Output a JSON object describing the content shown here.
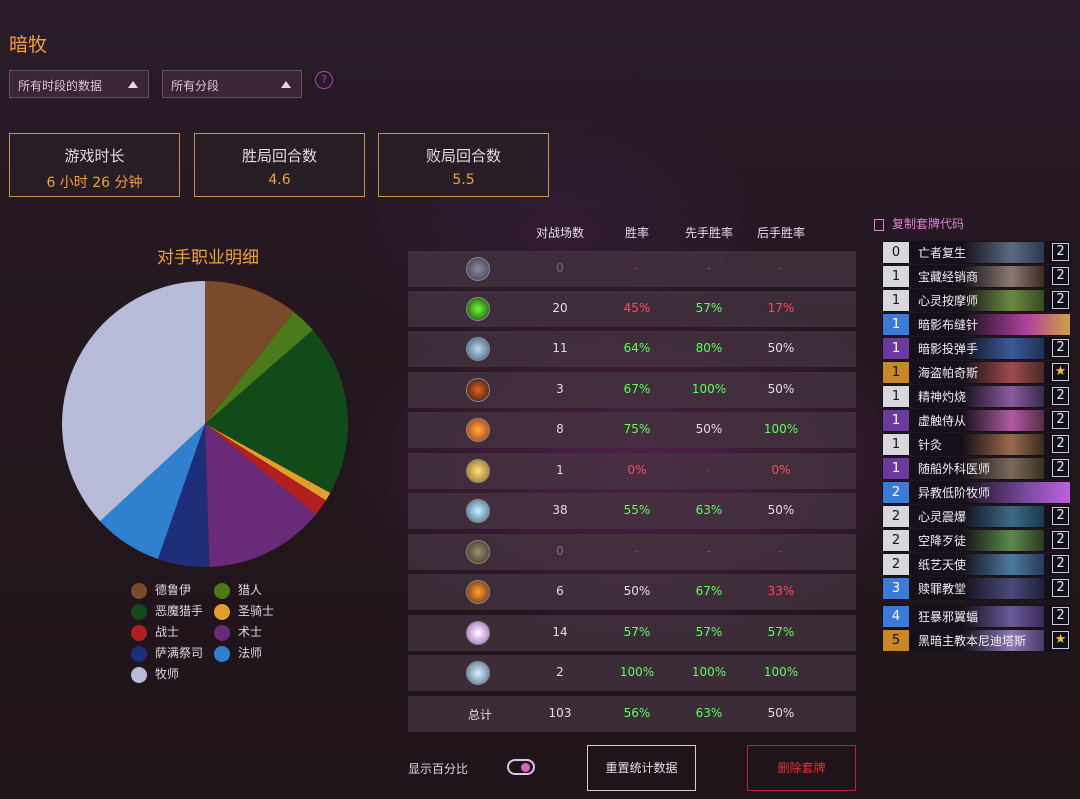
{
  "header": {
    "title": "暗牧"
  },
  "filters": {
    "time_range": "所有时段的数据",
    "rank_range": "所有分段",
    "help": "?"
  },
  "stats": [
    {
      "label": "游戏时长",
      "value": "6 小时 26 分钟"
    },
    {
      "label": "胜局回合数",
      "value": "4.6"
    },
    {
      "label": "败局回合数",
      "value": "5.5"
    }
  ],
  "chart_data": {
    "type": "pie",
    "title": "对手职业明细",
    "labels": [
      "德鲁伊",
      "猎人",
      "恶魔猎手",
      "圣骑士",
      "战士",
      "术士",
      "萨满祭司",
      "法师",
      "牧师"
    ],
    "values": [
      11,
      3,
      20,
      1,
      2,
      14,
      6,
      8,
      38
    ],
    "colors": [
      "#7a4a2a",
      "#4a7a1a",
      "#134a1a",
      "#e0a02a",
      "#b02020",
      "#6a2a7a",
      "#1e2e7a",
      "#3080d0",
      "#b8bcd8"
    ]
  },
  "legend": [
    {
      "label": "德鲁伊",
      "color": "#7a4a2a"
    },
    {
      "label": "猎人",
      "color": "#4a7a1a"
    },
    {
      "label": "恶魔猎手",
      "color": "#134a1a"
    },
    {
      "label": "圣骑士",
      "color": "#e0a02a"
    },
    {
      "label": "战士",
      "color": "#b02020"
    },
    {
      "label": "术士",
      "color": "#6a2a7a"
    },
    {
      "label": "萨满祭司",
      "color": "#1e2e7a"
    },
    {
      "label": "法师",
      "color": "#3080d0"
    },
    {
      "label": "牧师",
      "color": "#b8bcd8"
    }
  ],
  "table": {
    "headers": [
      "对战场数",
      "胜率",
      "先手胜率",
      "后手胜率"
    ],
    "rows": [
      {
        "icon": "rogue-icon",
        "games": "0",
        "wr": "-",
        "first": "-",
        "second": "-"
      },
      {
        "icon": "demon-hunter-icon",
        "games": "20",
        "wr": "45%",
        "first": "57%",
        "second": "17%"
      },
      {
        "icon": "druid-icon",
        "games": "11",
        "wr": "64%",
        "first": "80%",
        "second": "50%"
      },
      {
        "icon": "warrior-icon",
        "games": "3",
        "wr": "67%",
        "first": "100%",
        "second": "50%"
      },
      {
        "icon": "mage-icon",
        "games": "8",
        "wr": "75%",
        "first": "50%",
        "second": "100%"
      },
      {
        "icon": "paladin-icon",
        "games": "1",
        "wr": "0%",
        "first": "-",
        "second": "0%"
      },
      {
        "icon": "priest-icon",
        "games": "38",
        "wr": "55%",
        "first": "63%",
        "second": "50%"
      },
      {
        "icon": "hunter-icon",
        "games": "0",
        "wr": "-",
        "first": "-",
        "second": "-"
      },
      {
        "icon": "shaman-icon",
        "games": "6",
        "wr": "50%",
        "first": "67%",
        "second": "33%"
      },
      {
        "icon": "warlock-icon",
        "games": "14",
        "wr": "57%",
        "first": "57%",
        "second": "57%"
      },
      {
        "icon": "death-knight-icon",
        "games": "2",
        "wr": "100%",
        "first": "100%",
        "second": "100%"
      }
    ],
    "total": {
      "label": "总计",
      "games": "103",
      "wr": "56%",
      "first": "63%",
      "second": "50%"
    }
  },
  "controls": {
    "show_percent": "显示百分比",
    "reset": "重置统计数据",
    "delete": "删除套牌"
  },
  "deck": {
    "copy_code": "复制套牌代码",
    "cards": [
      {
        "cost": "0",
        "name": "亡者复生",
        "count": "2"
      },
      {
        "cost": "1",
        "name": "宝藏经销商",
        "count": "2"
      },
      {
        "cost": "1",
        "name": "心灵按摩师",
        "count": "2"
      },
      {
        "cost": "1",
        "name": "暗影布缝针",
        "count": ""
      },
      {
        "cost": "1",
        "name": "暗影投弹手",
        "count": "2"
      },
      {
        "cost": "1",
        "name": "海盗帕奇斯",
        "count": "★"
      },
      {
        "cost": "1",
        "name": "精神灼烧",
        "count": "2"
      },
      {
        "cost": "1",
        "name": "虚触侍从",
        "count": "2"
      },
      {
        "cost": "1",
        "name": "针灸",
        "count": "2"
      },
      {
        "cost": "1",
        "name": "随船外科医师",
        "count": "2"
      },
      {
        "cost": "2",
        "name": "异教低阶牧师",
        "count": ""
      },
      {
        "cost": "2",
        "name": "心灵震爆",
        "count": "2"
      },
      {
        "cost": "2",
        "name": "空降歹徒",
        "count": "2"
      },
      {
        "cost": "2",
        "name": "纸艺天使",
        "count": "2"
      },
      {
        "cost": "3",
        "name": "赎罪教堂",
        "count": "2"
      },
      {
        "cost": "4",
        "name": "狂暴邪翼蝠",
        "count": "2"
      },
      {
        "cost": "5",
        "name": "黑暗主教本尼迪塔斯",
        "count": "★"
      }
    ]
  }
}
